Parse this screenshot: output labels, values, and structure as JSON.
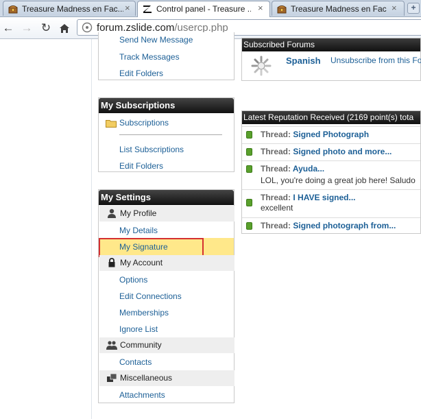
{
  "browser": {
    "tabs": [
      {
        "title": "Treasure Madness en Fac...",
        "close": "×",
        "favicon": "treasure-chest-icon",
        "active": false
      },
      {
        "title": "Control panel - Treasure ...",
        "close": "×",
        "favicon": "zslide-logo-icon",
        "active": true
      },
      {
        "title": "Treasure Madness en Fac...",
        "close": "×",
        "favicon": "treasure-chest-icon",
        "active": false
      }
    ],
    "new_tab": "+",
    "address": {
      "domain": "forum.zslide.com",
      "path": "/usercp.php"
    }
  },
  "sidebar": {
    "messages": {
      "links": [
        "Send New Message",
        "Track Messages",
        "Edit Folders"
      ]
    },
    "subscriptions": {
      "title": "My Subscriptions",
      "folder_link": "Subscriptions",
      "links": [
        "List Subscriptions",
        "Edit Folders"
      ]
    },
    "settings": {
      "title": "My Settings",
      "sections": {
        "profile": "My Profile",
        "account": "My Account",
        "community": "Community",
        "misc": "Miscellaneous"
      },
      "links": {
        "details": "My Details",
        "signature": "My Signature",
        "options": "Options",
        "connections": "Edit Connections",
        "memberships": "Memberships",
        "ignore": "Ignore List",
        "contacts": "Contacts",
        "attachments": "Attachments"
      }
    }
  },
  "main": {
    "subscribed_forums": {
      "title": "Subscribed Forums",
      "forum_name": "Spanish",
      "unsubscribe": "Unsubscribe from this Fo"
    },
    "reputation": {
      "title": "Latest Reputation Received (2169 point(s) tota",
      "prefix": "Thread:",
      "items": [
        {
          "thread": "Signed Photograph",
          "comment": ""
        },
        {
          "thread": "Signed photo and more...",
          "comment": ""
        },
        {
          "thread": "Ayuda...",
          "comment": "LOL, you're doing a great job here! Saludo"
        },
        {
          "thread": "I HAVE signed...",
          "comment": "excellent"
        },
        {
          "thread": "Signed photograph from...",
          "comment": ""
        }
      ]
    }
  },
  "colors": {
    "highlight": "#ffe88a",
    "highlight_border": "#d43030",
    "link": "#1c5f96",
    "rep_dot": "#5aa02c"
  }
}
